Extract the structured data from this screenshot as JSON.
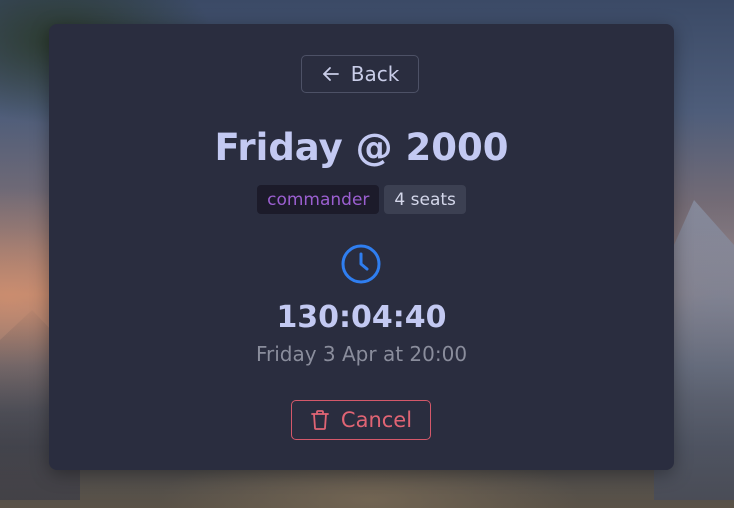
{
  "navigation": {
    "back_label": "Back"
  },
  "event": {
    "title": "Friday @ 2000",
    "format_badge": "commander",
    "seats_badge": "4 seats",
    "countdown": "130:04:40",
    "date_text": "Friday 3 Apr at 20:00"
  },
  "actions": {
    "cancel_label": "Cancel"
  },
  "icons": {
    "back": "arrow-left-icon",
    "clock": "clock-icon",
    "cancel": "trash-icon"
  },
  "colors": {
    "card_background": "#2a2d3f",
    "title": "#c3c9f2",
    "clock_accent": "#2f7ef0",
    "format_badge_text": "#9b5fd0",
    "cancel": "#e06474"
  }
}
